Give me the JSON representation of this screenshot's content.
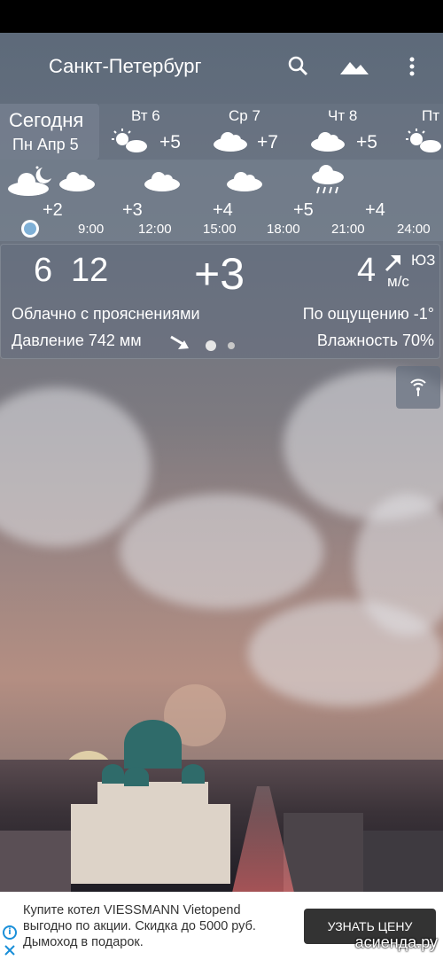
{
  "header": {
    "city": "Санкт-Петербург"
  },
  "daily": [
    {
      "day": "Сегодня",
      "date": "Пн Апр 5",
      "icon": "partly-cloudy-night-icon"
    },
    {
      "day": "Вт 6",
      "temp": "+5",
      "icon": "partly-sunny-icon"
    },
    {
      "day": "Ср 7",
      "temp": "+7",
      "icon": "cloud-icon"
    },
    {
      "day": "Чт 8",
      "temp": "+5",
      "icon": "cloud-icon"
    },
    {
      "day": "Пт",
      "icon": "partly-sunny-icon"
    }
  ],
  "hourly": [
    {
      "temp": "+2",
      "time": "9:00",
      "icon": "cloud-icon"
    },
    {
      "temp": "+3",
      "time": "12:00",
      "icon": "cloud-icon"
    },
    {
      "temp": "+4",
      "time": "15:00",
      "icon": "cloud-icon"
    },
    {
      "temp": "+5",
      "time": "18:00",
      "icon": "rain-cloud-icon"
    },
    {
      "temp": "+4",
      "time": "21:00",
      "icon": ""
    },
    {
      "temp": "",
      "time": "24:00",
      "icon": ""
    }
  ],
  "current": {
    "time_hour": "6",
    "time_min": "12",
    "temp": "+3",
    "wind_speed": "4",
    "wind_dir": "ЮЗ",
    "wind_unit": "м/с",
    "condition": "Облачно с прояснениями",
    "feels_like": "По ощущению -1°",
    "pressure": "Давление 742 мм",
    "humidity": "Влажность 70%"
  },
  "ad": {
    "text": "Купите котел VIESSMANN Vietopend выгодно по акции. Скидка до 5000 руб. Дымоход в подарок.",
    "button": "УЗНАТЬ ЦЕНУ"
  },
  "watermark": "асиенда.ру"
}
